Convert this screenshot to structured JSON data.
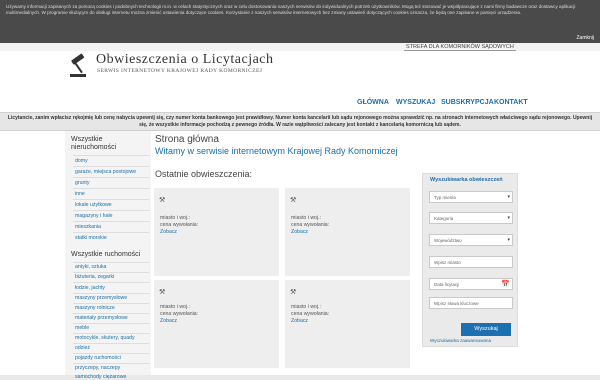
{
  "cookie": {
    "text": "Używamy informacji zapisanych za pomocą cookies i podobnych technologii m.in. w celach statystycznych oraz w celu dostosowania naszych serwisów do indywidualnych potrzeb użytkowników. Mogą też stosować je współpracujące z nami firmy badawcze oraz dostawcy aplikacji multimedialnych. W programie służącym do obsługi internetu można zmienić ustawienia dotyczące cookies. Korzystanie z naszych serwisów internetowych bez zmiany ustawień dotyczących cookies oznacza, że będą one zapisane w pamięci urządzenia.",
    "close": "Zamknij"
  },
  "header": {
    "strefa": "STREFA DLA KOMORNIKÓW SĄDOWYCH",
    "title": "Obwieszczenia o Licytacjach",
    "subtitle": "SERWIS INTERNETOWY KRAJOWEJ RADY KOMORNICZEJ"
  },
  "nav": [
    "GŁÓWNA",
    "WYSZUKAJ",
    "SUBSKRYPCJA",
    "KONTAKT"
  ],
  "banner": "Licytancie, zanim wpłacisz rękojmię lub cenę nabycia upewnij się, czy numer konta bankowego jest prawidłowy. Numer konta kancelarii lub sądu rejonowego można sprawdzić np. na stronach internetowych właściwego sądu rejonowego. Upewnij się, że wszystkie informacje pochodzą z pewnego źródła. W razie wątpliwości zalecany jest kontakt z kancelarią komorniczą lub sądem.",
  "sidebar": {
    "heading1": "Wszystkie nieruchomości",
    "items1": [
      "domy",
      "garaże, miejsca postojowe",
      "grunty",
      "inne",
      "lokale użytkowe",
      "magazyny i hale",
      "mieszkania",
      "statki morskie"
    ],
    "heading2": "Wszystkie ruchomości",
    "items2": [
      "antyki, sztuka",
      "biżuteria, zegarki",
      "łodzie, jachty",
      "maszyny przemysłowe",
      "maszyny rolnicze",
      "materiały przemysłowe",
      "meble",
      "motocykle, skutery, quady",
      "odzież",
      "pojazdy ruchomości",
      "przyczepy, naczepy",
      "samochody ciężarowe"
    ]
  },
  "main": {
    "title": "Strona główna",
    "subtitle": "Witamy w serwisie internetowym Krajowej Rady Komorniczej",
    "recent": "Ostatnie obwieszczenia:",
    "cards": [
      {
        "icon": "gavel-icon",
        "place": "miasto i woj.:",
        "price": "cena wywołania:",
        "link": "Zobacz"
      },
      {
        "icon": "gavel-icon",
        "place": "miasto i woj.:",
        "price": "cena wywołania:",
        "link": "Zobacz"
      },
      {
        "icon": "gavel-icon",
        "place": "miasto i woj.:",
        "price": "cena wywołania:",
        "link": "Zobacz"
      },
      {
        "icon": "gavel-icon",
        "place": "miasto i woj.:",
        "price": "cena wywołania:",
        "link": "Zobacz"
      }
    ]
  },
  "search": {
    "title": "Wyszukiwarka obwieszczeń",
    "type": "Typ mienia",
    "category": "Kategoria",
    "voivodeship": "Województwo",
    "city": "Wpisz miasto",
    "date": "Data licytacji",
    "keyword": "Wpisz słowa kluczowe",
    "button": "Wyszukaj",
    "advanced": "Wyszukiwarka zaawansowana"
  },
  "colors": {
    "link": "#1a6fa8",
    "button": "#1c70b0",
    "cookie_bg": "#4a4a4a"
  }
}
